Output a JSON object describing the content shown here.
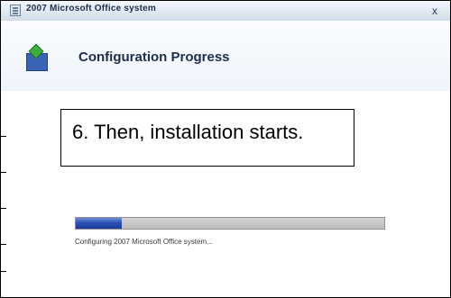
{
  "window": {
    "title": "2007 Microsoft Office system",
    "close_label": "x"
  },
  "header": {
    "title": "Configuration Progress"
  },
  "callout": {
    "text": "6. Then, installation starts."
  },
  "progress": {
    "value_percent": 15,
    "status_text": "Configuring 2007 Microsoft Office system..."
  },
  "colors": {
    "progress_fill": "#2d52b3",
    "progress_track": "#c8c8c8",
    "header_bg": "#eef4fb"
  },
  "icons": {
    "title_icon": "office-setup-icon",
    "header_icon": "install-package-icon",
    "close_icon": "close-icon"
  }
}
